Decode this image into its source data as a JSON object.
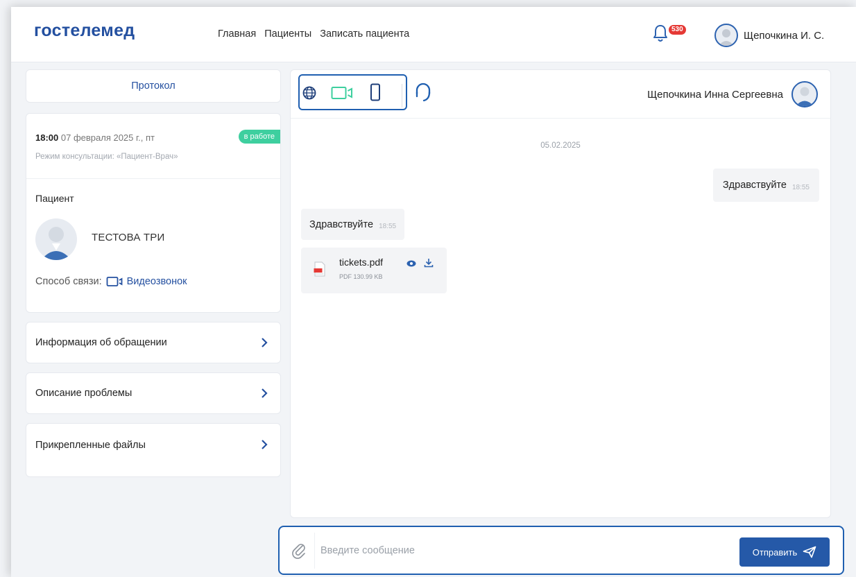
{
  "header": {
    "logo": "гостелемед",
    "nav": [
      "Главная",
      "Пациенты",
      "Записать пациента"
    ],
    "notifications_count": "530",
    "user_name": "Щепочкина И. С."
  },
  "sidebar": {
    "protocol_label": "Протокол",
    "appointment": {
      "time": "18:00",
      "date": "07 февраля 2025 г., пт",
      "status": "в работе",
      "mode": "Режим консультации: «Пациент-Врач»"
    },
    "patient": {
      "label": "Пациент",
      "name": "ТЕСТОВА ТРИ",
      "contact_label": "Способ связи:",
      "contact_method": "Видеозвонок"
    },
    "sections": [
      "Информация об обращении",
      "Описание проблемы",
      "Прикрепленные файлы"
    ]
  },
  "chat": {
    "interlocutor": "Щепочкина Инна Сергеевна",
    "date_separator": "05.02.2025",
    "messages": [
      {
        "direction": "out",
        "text": "Здравствуйте",
        "time": "18:55"
      },
      {
        "direction": "in",
        "text": "Здравствуйте",
        "time": "18:55"
      }
    ],
    "file": {
      "name": "tickets.pdf",
      "meta": "PDF 130.99 KB"
    }
  },
  "composer": {
    "placeholder": "Введите сообщение",
    "send_label": "Отправить"
  },
  "colors": {
    "brand": "#2450a0",
    "accent": "#1f5fb0",
    "status_green": "#3ecf9f",
    "badge_red": "#e53935"
  }
}
